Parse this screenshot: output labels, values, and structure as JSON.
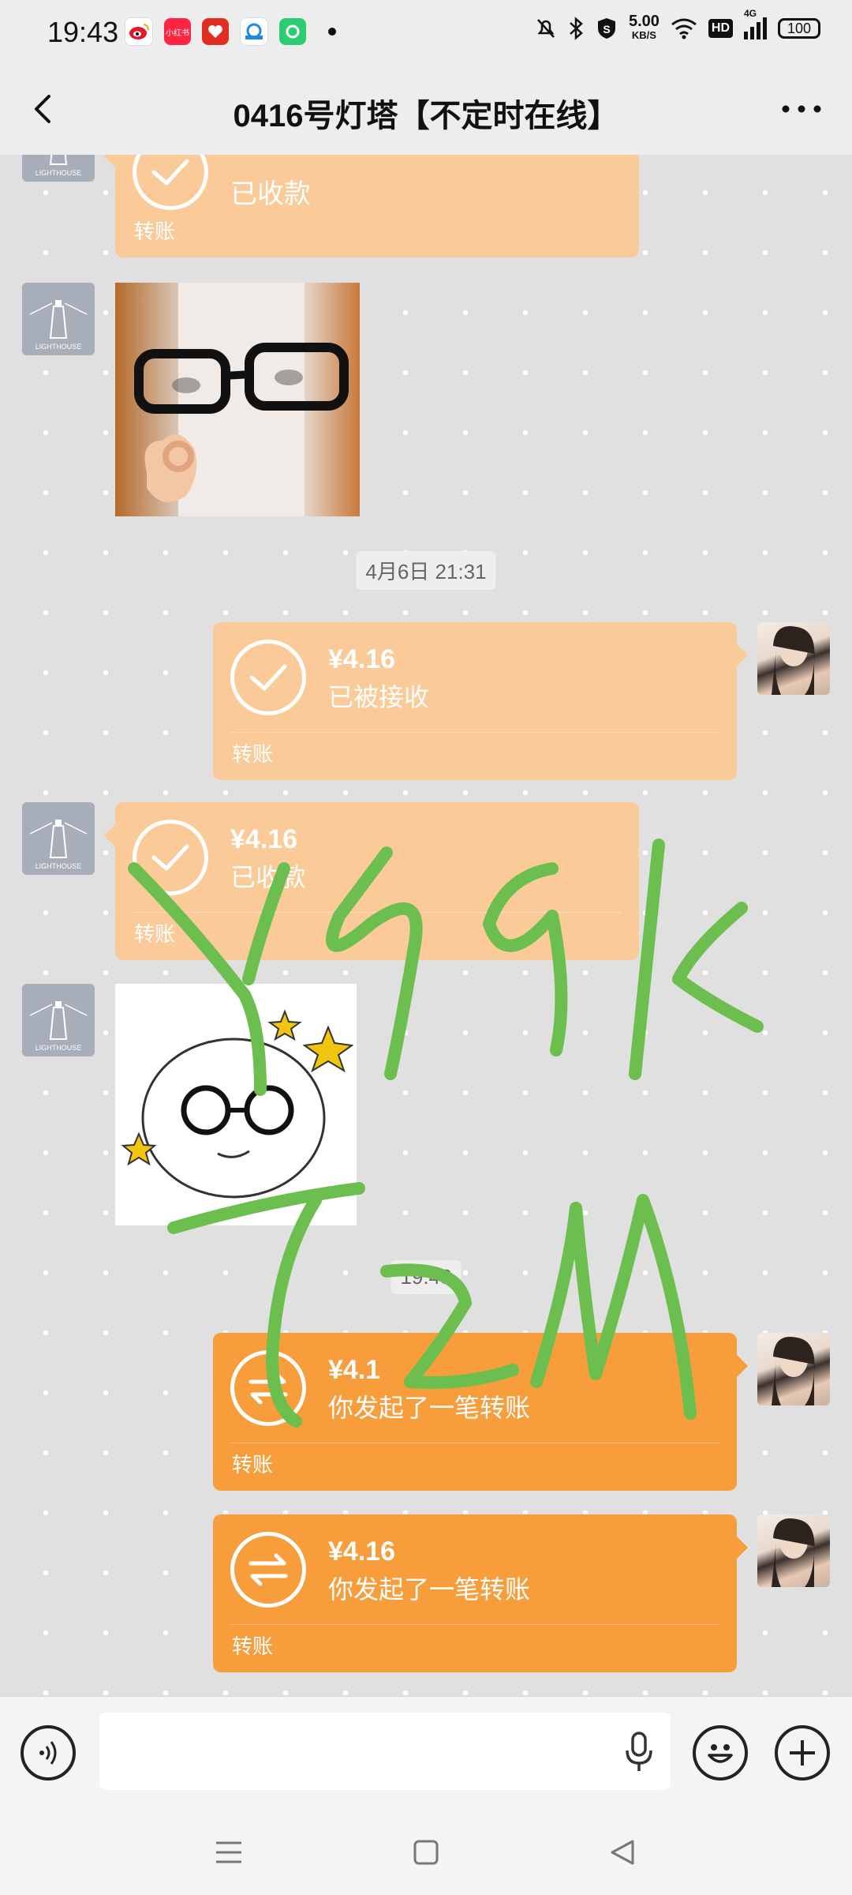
{
  "status_bar": {
    "time": "19:43",
    "net_speed_value": "5.00",
    "net_speed_unit": "KB/S",
    "hd": "HD",
    "signal": "4G",
    "battery": "100",
    "app_icons": [
      "weibo-icon",
      "xiaohongshu-icon",
      "pinduoduo-icon",
      "browser-icon",
      "app-icon"
    ],
    "xhs_text": "小红书"
  },
  "header": {
    "title": "0416号灯塔【不定时在线】"
  },
  "chat": {
    "messages": [
      {
        "status": "已收款",
        "label": "转账"
      },
      {
        "amount": "¥4.16",
        "status": "已被接收",
        "label": "转账"
      },
      {
        "amount": "¥4.16",
        "status": "已收款",
        "label": "转账"
      },
      {
        "amount": "¥4.1",
        "status": "你发起了一笔转账",
        "label": "转账"
      },
      {
        "amount": "¥4.16",
        "status": "你发起了一笔转账",
        "label": "转账"
      }
    ],
    "timestamps": [
      "4月6日 21:31",
      "19:43"
    ],
    "avatar_text": "LIGHTHOUSE"
  },
  "overlay": {
    "line1": "Y59K",
    "line2": "T2M",
    "color": "#6cbf4f"
  },
  "colors": {
    "accepted_bubble": "#fbca99",
    "pending_bubble": "#f89d3b"
  }
}
